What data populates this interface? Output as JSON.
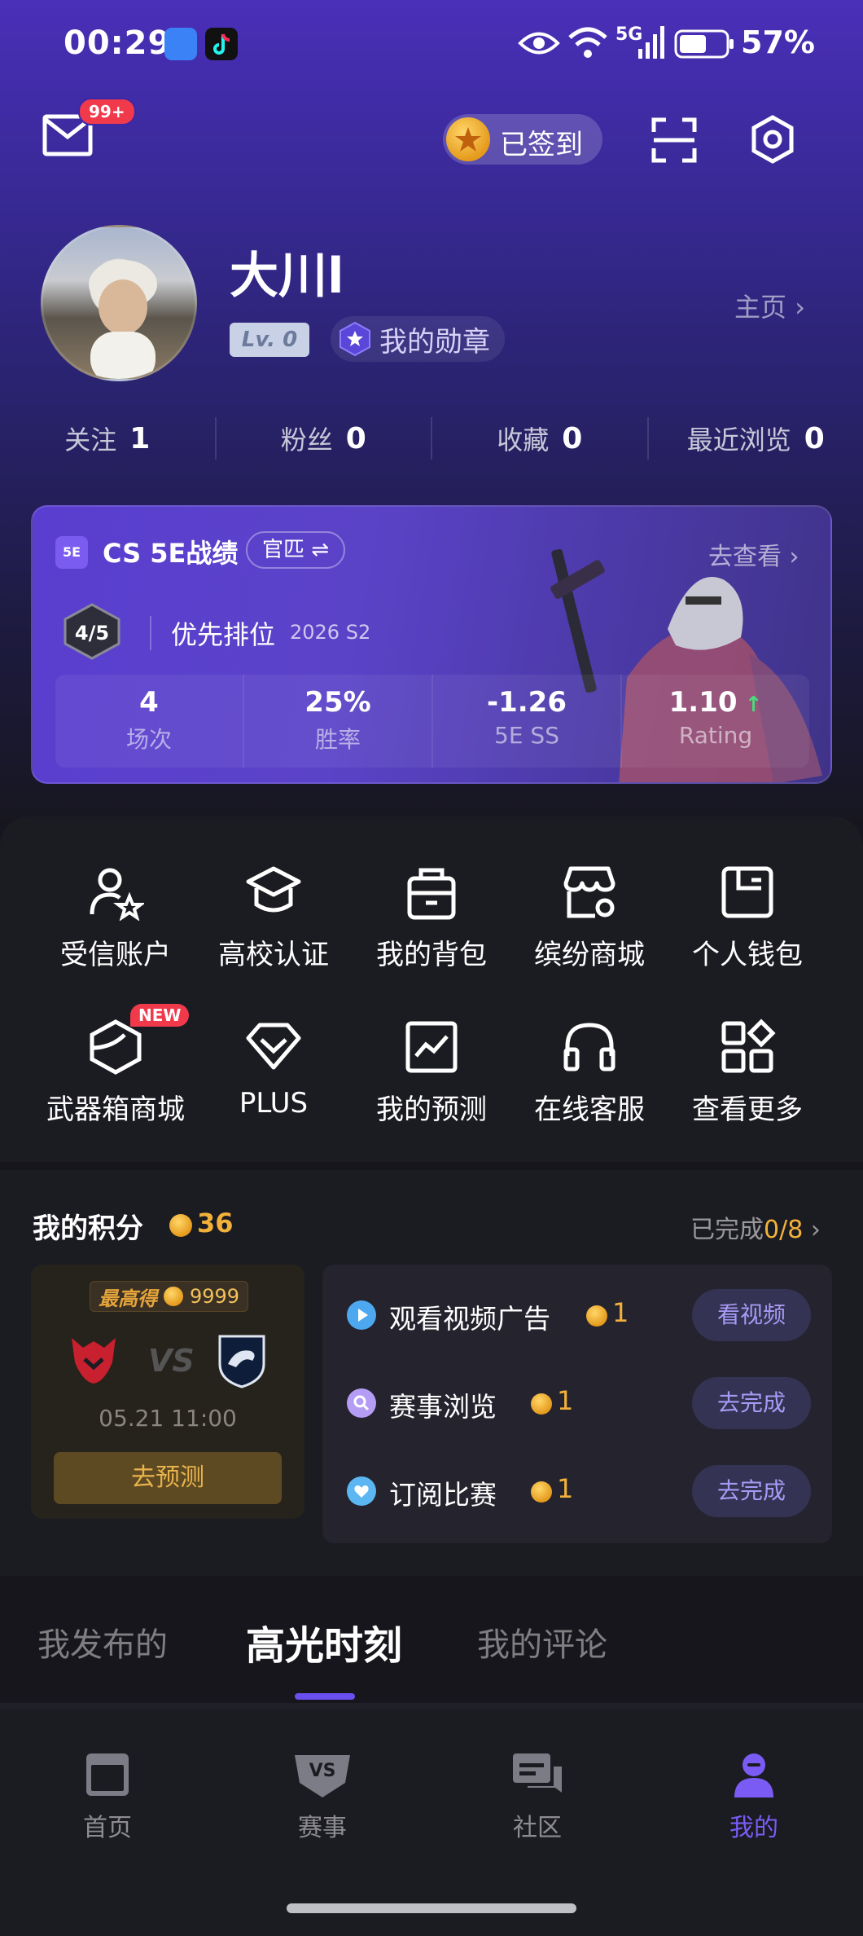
{
  "status_bar": {
    "time": "00:29",
    "network": "5G",
    "battery": "57%",
    "icons": [
      "app-market-icon",
      "tiktok-icon",
      "eye-icon",
      "wifi-icon",
      "signal-icon",
      "battery-icon"
    ]
  },
  "header": {
    "mail_badge": "99+",
    "checkin_label": "已签到",
    "icons": [
      "mail-icon",
      "coin-icon",
      "scan-icon",
      "settings-icon"
    ]
  },
  "profile": {
    "username": "大川l",
    "level": "Lv. 0",
    "medal_label": "我的勋章",
    "homepage_link": "主页",
    "stats": [
      {
        "label": "关注",
        "value": "1"
      },
      {
        "label": "粉丝",
        "value": "0"
      },
      {
        "label": "收藏",
        "value": "0"
      },
      {
        "label": "最近浏览",
        "value": "0"
      }
    ]
  },
  "cs_card": {
    "logo": "5E",
    "title": "CS 5E战绩",
    "mode": "官匹 ⇌",
    "goto": "去查看",
    "rank_badge": "4/5",
    "rank_name": "优先排位",
    "season": "2026 S2",
    "stats": [
      {
        "value": "4",
        "label": "场次"
      },
      {
        "value": "25%",
        "label": "胜率"
      },
      {
        "value": "-1.26",
        "label": "5E SS"
      },
      {
        "value": "1.10",
        "label": "Rating"
      }
    ]
  },
  "menu": {
    "items": [
      {
        "label": "受信账户",
        "icon": "trusted-account-icon"
      },
      {
        "label": "高校认证",
        "icon": "graduation-cap-icon"
      },
      {
        "label": "我的背包",
        "icon": "backpack-icon"
      },
      {
        "label": "缤纷商城",
        "icon": "store-icon"
      },
      {
        "label": "个人钱包",
        "icon": "wallet-icon"
      },
      {
        "label": "武器箱商城",
        "icon": "weapon-case-icon"
      },
      {
        "label": "PLUS",
        "icon": "diamond-icon"
      },
      {
        "label": "我的预测",
        "icon": "prediction-chart-icon"
      },
      {
        "label": "在线客服",
        "icon": "headset-icon"
      },
      {
        "label": "查看更多",
        "icon": "grid-more-icon"
      }
    ],
    "new_badge": "NEW"
  },
  "points": {
    "title": "我的积分",
    "value": "36",
    "completed_label": "已完成",
    "completed_value": "0/8",
    "predict": {
      "tag_label": "最高得",
      "tag_value": "9999",
      "vs": "VS",
      "date": "05.21 11:00",
      "button": "去预测"
    },
    "tasks": [
      {
        "label": "观看视频广告",
        "points": "1",
        "button": "看视频",
        "color": "#4ea8f0"
      },
      {
        "label": "赛事浏览",
        "points": "1",
        "button": "去完成",
        "color": "#b59cf5"
      },
      {
        "label": "订阅比赛",
        "points": "1",
        "button": "去完成",
        "color": "#5cb6f2"
      }
    ]
  },
  "tabs": [
    "我发布的",
    "高光时刻",
    "我的评论"
  ],
  "nav": [
    {
      "label": "首页",
      "icon": "home-icon"
    },
    {
      "label": "赛事",
      "icon": "vs-match-icon"
    },
    {
      "label": "社区",
      "icon": "community-icon"
    },
    {
      "label": "我的",
      "icon": "profile-icon"
    }
  ],
  "colors": {
    "accent": "#6a4ff0",
    "gold": "#f2b23a",
    "badge_red": "#f03a4b"
  }
}
